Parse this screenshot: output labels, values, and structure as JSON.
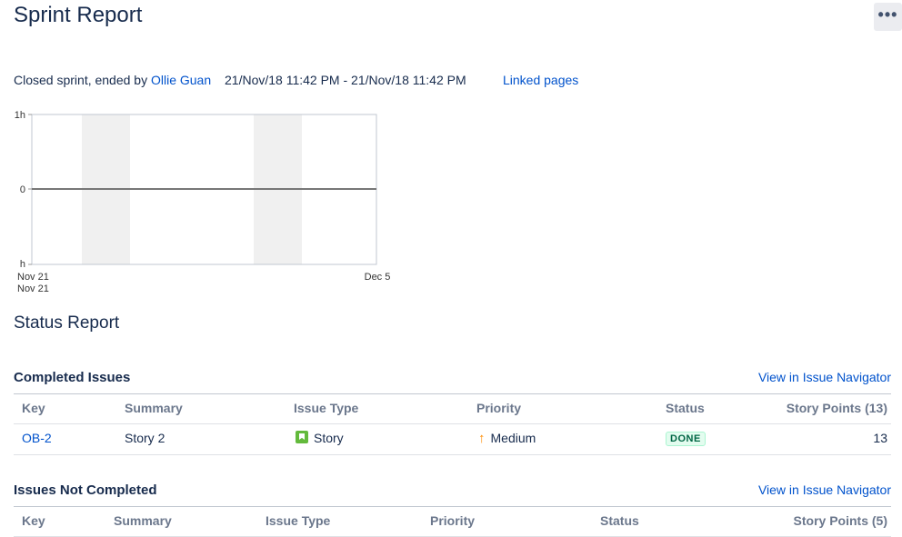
{
  "page": {
    "title": "Sprint Report",
    "more_label": "•••"
  },
  "sprint_meta": {
    "prefix": "Closed sprint, ended by ",
    "user": "Ollie Guan",
    "dates": "21/Nov/18 11:42 PM - 21/Nov/18 11:42 PM",
    "linked_pages": "Linked pages"
  },
  "chart_data": {
    "type": "line",
    "y_ticks": [
      "1h",
      "0",
      "h"
    ],
    "x_ticks": [
      "Nov 21",
      "Nov 21",
      "Dec 5"
    ],
    "series": [
      {
        "values": [
          0,
          0
        ]
      }
    ],
    "shaded_bands": 2
  },
  "status_report": {
    "title": "Status Report"
  },
  "completed": {
    "title": "Completed Issues",
    "nav_link": "View in Issue Navigator",
    "headers": {
      "key": "Key",
      "summary": "Summary",
      "type": "Issue Type",
      "priority": "Priority",
      "status": "Status",
      "points": "Story Points (13)"
    },
    "rows": [
      {
        "key": "OB-2",
        "summary": "Story 2",
        "type": "Story",
        "priority": "Medium",
        "status": "DONE",
        "points": "13"
      }
    ]
  },
  "not_completed": {
    "title": "Issues Not Completed",
    "nav_link": "View in Issue Navigator",
    "headers": {
      "key": "Key",
      "summary": "Summary",
      "type": "Issue Type",
      "priority": "Priority",
      "status": "Status",
      "points": "Story Points (5)"
    }
  }
}
